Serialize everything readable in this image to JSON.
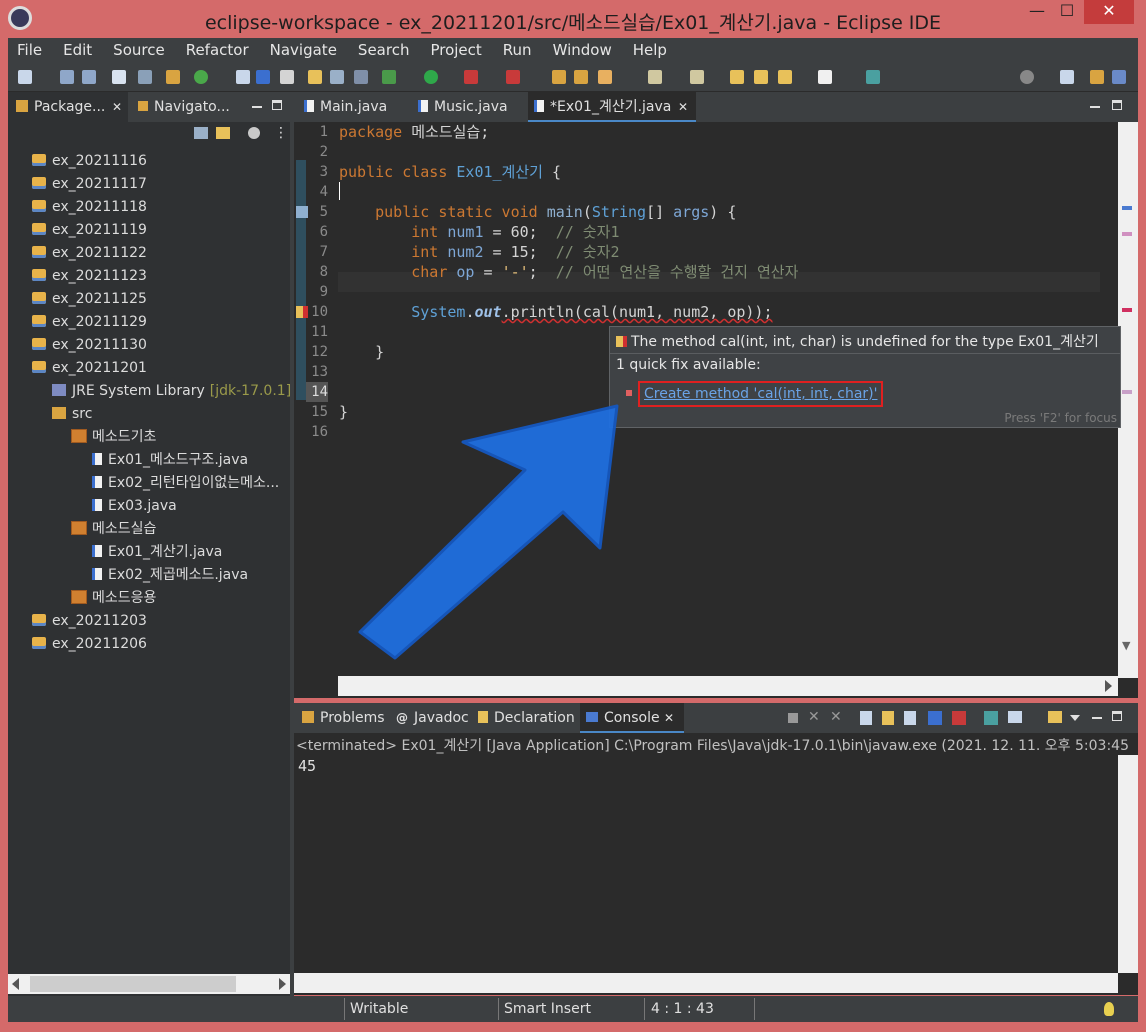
{
  "window": {
    "title": "eclipse-workspace - ex_20211201/src/메소드실습/Ex01_계산기.java - Eclipse IDE",
    "min": "—",
    "max": "☐",
    "close": "✕"
  },
  "menu": [
    "File",
    "Edit",
    "Source",
    "Refactor",
    "Navigate",
    "Search",
    "Project",
    "Run",
    "Window",
    "Help"
  ],
  "left_tabs": [
    {
      "label": "Package...",
      "close": "✕"
    },
    {
      "label": "Navigato..."
    }
  ],
  "tree": [
    {
      "label": "ex_20211116",
      "type": "project",
      "indent": 0
    },
    {
      "label": "ex_20211117",
      "type": "project",
      "indent": 0
    },
    {
      "label": "ex_20211118",
      "type": "project",
      "indent": 0
    },
    {
      "label": "ex_20211119",
      "type": "project",
      "indent": 0
    },
    {
      "label": "ex_20211122",
      "type": "project",
      "indent": 0
    },
    {
      "label": "ex_20211123",
      "type": "project",
      "indent": 0
    },
    {
      "label": "ex_20211125",
      "type": "project",
      "indent": 0
    },
    {
      "label": "ex_20211129",
      "type": "project",
      "indent": 0
    },
    {
      "label": "ex_20211130",
      "type": "project",
      "indent": 0
    },
    {
      "label": "ex_20211201",
      "type": "project",
      "indent": 0
    },
    {
      "label": "JRE System Library",
      "suffix": "[jdk-17.0.1]",
      "type": "jar",
      "indent": 1
    },
    {
      "label": "src",
      "type": "folder",
      "indent": 1
    },
    {
      "label": "메소드기초",
      "type": "package",
      "indent": 2
    },
    {
      "label": "Ex01_메소드구조.java",
      "type": "java",
      "indent": 3
    },
    {
      "label": "Ex02_리턴타입이없는메소...",
      "type": "java",
      "indent": 3
    },
    {
      "label": "Ex03.java",
      "type": "java",
      "indent": 3
    },
    {
      "label": "메소드실습",
      "type": "package",
      "indent": 2
    },
    {
      "label": "Ex01_계산기.java",
      "type": "java",
      "indent": 3
    },
    {
      "label": "Ex02_제곱메소드.java",
      "type": "java",
      "indent": 3
    },
    {
      "label": "메소드응용",
      "type": "package",
      "indent": 2
    },
    {
      "label": "ex_20211203",
      "type": "project",
      "indent": 0
    },
    {
      "label": "ex_20211206",
      "type": "project",
      "indent": 0
    }
  ],
  "editor_tabs": [
    {
      "label": "Main.java"
    },
    {
      "label": "Music.java"
    },
    {
      "label": "*Ex01_계산기.java",
      "close": "✕",
      "active": true
    }
  ],
  "line_numbers": [
    "1",
    "2",
    "3",
    "4",
    "5",
    "6",
    "7",
    "8",
    "9",
    "10",
    "11",
    "12",
    "13",
    "14",
    "15",
    "16"
  ],
  "code": {
    "l1a": "package",
    "l1b": " 메소드실습;",
    "l3a": "public class",
    "l3b": " Ex01_계산기",
    "l3c": " {",
    "l5a": "    public static void",
    "l5b": " main",
    "l5c": "(",
    "l5d": "String",
    "l5e": "[] ",
    "l5f": "args",
    "l5g": ") {",
    "l6a": "        int",
    "l6b": " num1",
    "l6c": " = 60;  ",
    "l6d": "// 숫자1",
    "l7a": "        int",
    "l7b": " num2",
    "l7c": " = 15;  ",
    "l7d": "// 숫자2",
    "l8a": "        char",
    "l8b": " op",
    "l8c": " = ",
    "l8d": "'-'",
    "l8e": ";  ",
    "l8f": "// 어떤 연산을 수행할 건지 연산자",
    "l10a": "        System",
    "l10b": ".",
    "l10c": "out",
    "l10d": ".println(cal(num1, num2, op));",
    "l12": "    }",
    "l15": "}"
  },
  "hover": {
    "error": "The method cal(int, int, char) is undefined for the type Ex01_계산기",
    "count": "1 quick fix available:",
    "fix": "Create method 'cal(int, int, char)'",
    "footer": "Press 'F2' for focus"
  },
  "bottom_tabs": [
    {
      "label": "Problems"
    },
    {
      "label": "Javadoc"
    },
    {
      "label": "Declaration"
    },
    {
      "label": "Console",
      "close": "✕",
      "active": true
    }
  ],
  "console": {
    "terminated": "<terminated> Ex01_계산기 [Java Application] C:\\Program Files\\Java\\jdk-17.0.1\\bin\\javaw.exe  (2021. 12. 11. 오후 5:03:45",
    "output": "45"
  },
  "status": {
    "writable": "Writable",
    "insert": "Smart Insert",
    "pos": "4 : 1 : 43"
  },
  "colors": {
    "accent_red": "#e02020",
    "arrow_blue": "#1f6fe0",
    "frame": "#d46a6a"
  }
}
